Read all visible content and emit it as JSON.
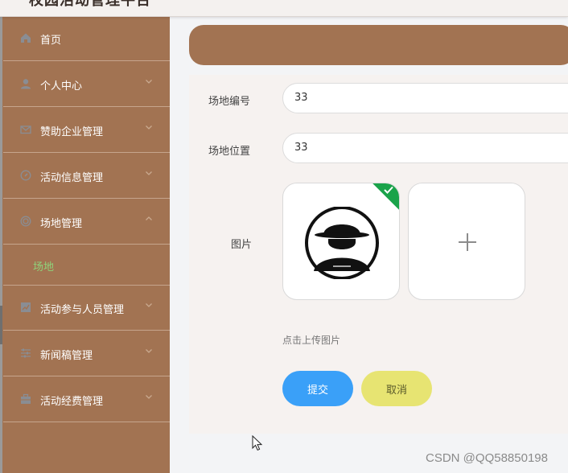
{
  "header": {
    "title": "校园活动管理平台"
  },
  "sidebar": {
    "items": [
      {
        "label": "首页",
        "icon": "home-icon",
        "has_chevron": false
      },
      {
        "label": "个人中心",
        "icon": "user-icon",
        "has_chevron": true,
        "chevron": "down"
      },
      {
        "label": "赞助企业管理",
        "icon": "mail-icon",
        "has_chevron": true,
        "chevron": "down"
      },
      {
        "label": "活动信息管理",
        "icon": "compass-icon",
        "has_chevron": true,
        "chevron": "down"
      },
      {
        "label": "场地管理",
        "icon": "target-icon",
        "has_chevron": true,
        "chevron": "up"
      },
      {
        "label": "活动参与人员管理",
        "icon": "chart-icon",
        "has_chevron": true,
        "chevron": "down"
      },
      {
        "label": "新闻稿管理",
        "icon": "sliders-icon",
        "has_chevron": true,
        "chevron": "down"
      },
      {
        "label": "活动经费管理",
        "icon": "briefcase-icon",
        "has_chevron": true,
        "chevron": "down"
      }
    ],
    "active_sub_item": {
      "label": "场地"
    }
  },
  "form": {
    "venue_number": {
      "label": "场地编号",
      "value": "33"
    },
    "venue_location": {
      "label": "场地位置",
      "value": "33"
    },
    "image": {
      "label": "图片",
      "hint": "点击上传图片"
    },
    "buttons": {
      "submit": "提交",
      "cancel": "取消"
    }
  },
  "watermark": "CSDN @QQ58850198",
  "colors": {
    "sidebar_bg": "#a27352",
    "sidebar_active_text": "#8fd37a",
    "submit_button": "#3aa0f8",
    "cancel_button": "#e7e472",
    "upload_success_badge": "#1aa34a"
  }
}
